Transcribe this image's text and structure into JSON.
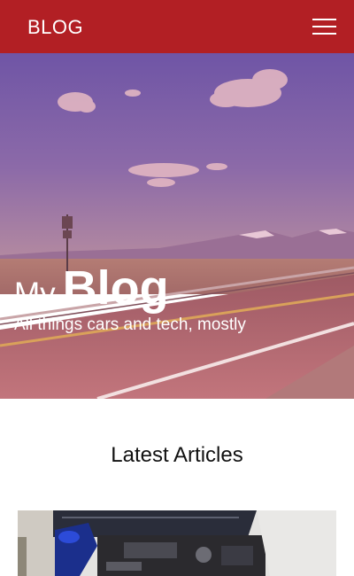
{
  "header": {
    "brand": "BLOG",
    "menu_icon": "hamburger-menu-icon",
    "background": "#b21f24"
  },
  "hero": {
    "title_small": "My",
    "title_big": "Blog",
    "subtitle": "All things cars and tech, mostly",
    "image_description_icon": "road-landscape-image"
  },
  "articles": {
    "section_title": "Latest Articles",
    "cards": [
      {
        "image": "car-engine-image"
      }
    ]
  }
}
